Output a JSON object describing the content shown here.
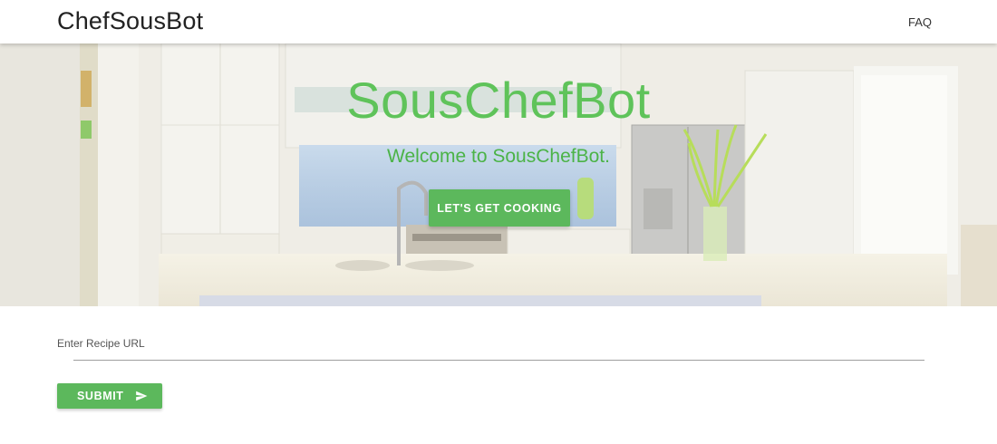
{
  "header": {
    "brand": "ChefSousBot",
    "nav_faq": "FAQ"
  },
  "hero": {
    "title": "SousChefBot",
    "subtitle": "Welcome to SousChefBot.",
    "cta_label": "LET'S GET COOKING"
  },
  "form": {
    "url_label": "Enter Recipe URL",
    "url_value": "",
    "submit_label": "SUBMIT",
    "submit_icon": "send-icon"
  },
  "colors": {
    "accent": "#5cb85c",
    "title_green": "#5fc35a"
  }
}
